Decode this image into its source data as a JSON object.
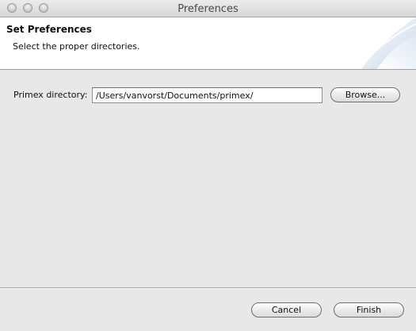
{
  "window": {
    "title": "Preferences"
  },
  "banner": {
    "title": "Set Preferences",
    "description": "Select the proper directories."
  },
  "form": {
    "primex_label": "Primex directory:",
    "primex_value": "/Users/vanvorst/Documents/primex/",
    "browse_label": "Browse..."
  },
  "footer": {
    "cancel_label": "Cancel",
    "finish_label": "Finish"
  },
  "icons": {
    "close": "close-icon",
    "minimize": "minimize-icon",
    "zoom": "zoom-icon",
    "banner_art": "banner-swoosh-graphic"
  },
  "colors": {
    "window_bg": "#e8e8e8",
    "banner_bg": "#ffffff",
    "banner_art": "#c9d7ea"
  }
}
